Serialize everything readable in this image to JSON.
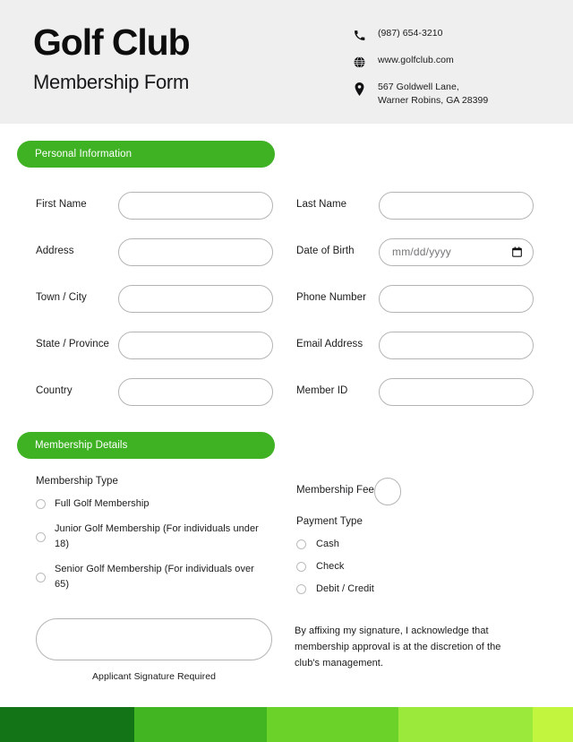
{
  "header": {
    "club_name": "Golf Club",
    "form_subtitle": "Membership Form",
    "contacts": [
      {
        "icon": "phone-icon",
        "text": "(987) 654-3210"
      },
      {
        "icon": "globe-icon",
        "text": "www.golfclub.com"
      },
      {
        "icon": "location-pin-icon",
        "text": "567 Goldwell Lane,\nWarner Robins, GA 28399"
      }
    ]
  },
  "sections": {
    "personal_information": {
      "title": "Personal Information",
      "left_fields": [
        {
          "label": "First Name",
          "value": ""
        },
        {
          "label": "Address",
          "value": ""
        },
        {
          "label": "Town / City",
          "value": ""
        },
        {
          "label": "State / Province",
          "value": ""
        },
        {
          "label": "Country",
          "value": ""
        }
      ],
      "right_fields": [
        {
          "label": "Last Name",
          "value": ""
        },
        {
          "label": "Date of Birth",
          "value": "",
          "placeholder": "mm/dd/yyyy",
          "has_date_picker": true
        },
        {
          "label": "Phone Number",
          "value": ""
        },
        {
          "label": "Email Address",
          "value": ""
        },
        {
          "label": "Member ID",
          "value": ""
        }
      ]
    },
    "membership_details": {
      "title": "Membership Details",
      "membership_type": {
        "title": "Membership Type",
        "options": [
          "Full Golf Membership",
          "Junior Golf Membership (For individuals under 18)",
          "Senior Golf Membership (For individuals over 65)"
        ]
      },
      "membership_fee": {
        "label": "Membership Fee",
        "value": ""
      },
      "payment_type": {
        "title": "Payment Type",
        "options": [
          "Cash",
          "Check",
          "Debit / Credit"
        ]
      }
    },
    "signature": {
      "value": "",
      "caption": "Applicant Signature Required",
      "disclaimer": "By affixing my signature, I acknowledge that membership approval is at the discretion of the club's management."
    }
  },
  "colors": {
    "accent_green": "#3fb224",
    "header_bg": "#efefef",
    "footer_bars": [
      "#137417",
      "#42b523",
      "#6bd22a",
      "#9ae93b",
      "#c2f63e"
    ]
  }
}
